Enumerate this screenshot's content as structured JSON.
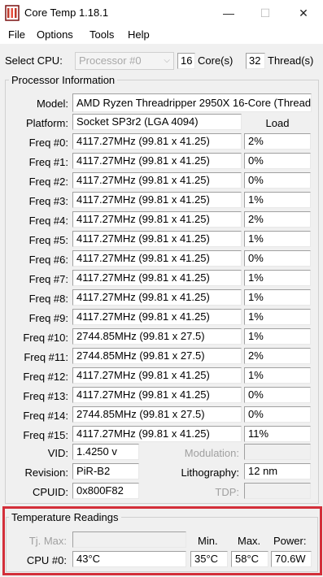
{
  "window": {
    "title": "Core Temp 1.18.1",
    "minimize": "—",
    "maximize": "☐",
    "close": "✕"
  },
  "menu": [
    "File",
    "Options",
    "Tools",
    "Help"
  ],
  "cpu_select": {
    "label": "Select CPU:",
    "value": "Processor #0",
    "cores": "16",
    "cores_label": "Core(s)",
    "threads": "32",
    "threads_label": "Thread(s)"
  },
  "processor_info": {
    "title": "Processor Information",
    "model_label": "Model:",
    "model": "AMD Ryzen Threadripper 2950X 16-Core (Threadr",
    "platform_label": "Platform:",
    "platform": "Socket SP3r2 (LGA 4094)",
    "load_label": "Load",
    "freqs": [
      {
        "label": "Freq #0:",
        "value": "4117.27MHz (99.81 x 41.25)",
        "load": "2%"
      },
      {
        "label": "Freq #1:",
        "value": "4117.27MHz (99.81 x 41.25)",
        "load": "0%"
      },
      {
        "label": "Freq #2:",
        "value": "4117.27MHz (99.81 x 41.25)",
        "load": "0%"
      },
      {
        "label": "Freq #3:",
        "value": "4117.27MHz (99.81 x 41.25)",
        "load": "1%"
      },
      {
        "label": "Freq #4:",
        "value": "4117.27MHz (99.81 x 41.25)",
        "load": "2%"
      },
      {
        "label": "Freq #5:",
        "value": "4117.27MHz (99.81 x 41.25)",
        "load": "1%"
      },
      {
        "label": "Freq #6:",
        "value": "4117.27MHz (99.81 x 41.25)",
        "load": "0%"
      },
      {
        "label": "Freq #7:",
        "value": "4117.27MHz (99.81 x 41.25)",
        "load": "1%"
      },
      {
        "label": "Freq #8:",
        "value": "4117.27MHz (99.81 x 41.25)",
        "load": "1%"
      },
      {
        "label": "Freq #9:",
        "value": "4117.27MHz (99.81 x 41.25)",
        "load": "1%"
      },
      {
        "label": "Freq #10:",
        "value": "2744.85MHz (99.81 x 27.5)",
        "load": "1%"
      },
      {
        "label": "Freq #11:",
        "value": "2744.85MHz (99.81 x 27.5)",
        "load": "2%"
      },
      {
        "label": "Freq #12:",
        "value": "4117.27MHz (99.81 x 41.25)",
        "load": "1%"
      },
      {
        "label": "Freq #13:",
        "value": "4117.27MHz (99.81 x 41.25)",
        "load": "0%"
      },
      {
        "label": "Freq #14:",
        "value": "2744.85MHz (99.81 x 27.5)",
        "load": "0%"
      },
      {
        "label": "Freq #15:",
        "value": "4117.27MHz (99.81 x 41.25)",
        "load": "11%"
      }
    ],
    "vid_label": "VID:",
    "vid": "1.4250 v",
    "modulation_label": "Modulation:",
    "revision_label": "Revision:",
    "revision": "PiR-B2",
    "lithography_label": "Lithography:",
    "lithography": "12 nm",
    "cpuid_label": "CPUID:",
    "cpuid": "0x800F82",
    "tdp_label": "TDP:"
  },
  "temperature": {
    "title": "Temperature Readings",
    "tjmax_label": "Tj. Max:",
    "min_label": "Min.",
    "max_label": "Max.",
    "power_label": "Power:",
    "cpu_label": "CPU #0:",
    "current": "43°C",
    "min": "35°C",
    "max": "58°C",
    "power": "70.6W"
  },
  "colors": {
    "highlight": "#d32f3a",
    "background": "#f0f0f0"
  }
}
